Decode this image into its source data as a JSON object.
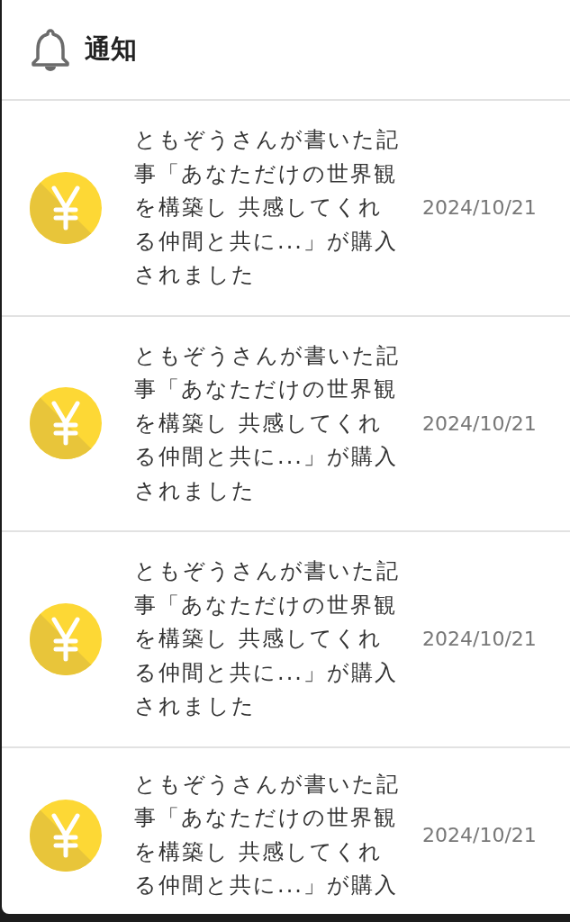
{
  "header": {
    "title": "通知"
  },
  "notifications": [
    {
      "message": "ともぞうさんが書いた記事「あなただけの世界観を構築し 共感してくれる仲間と共に...」が購入されました",
      "date": "2024/10/21"
    },
    {
      "message": "ともぞうさんが書いた記事「あなただけの世界観を構築し 共感してくれる仲間と共に...」が購入されました",
      "date": "2024/10/21"
    },
    {
      "message": "ともぞうさんが書いた記事「あなただけの世界観を構築し 共感してくれる仲間と共に...」が購入されました",
      "date": "2024/10/21"
    },
    {
      "message": "ともぞうさんが書いた記事「あなただけの世界観を構築し 共感してくれる仲間と共に...」が購入",
      "date": "2024/10/21"
    }
  ]
}
